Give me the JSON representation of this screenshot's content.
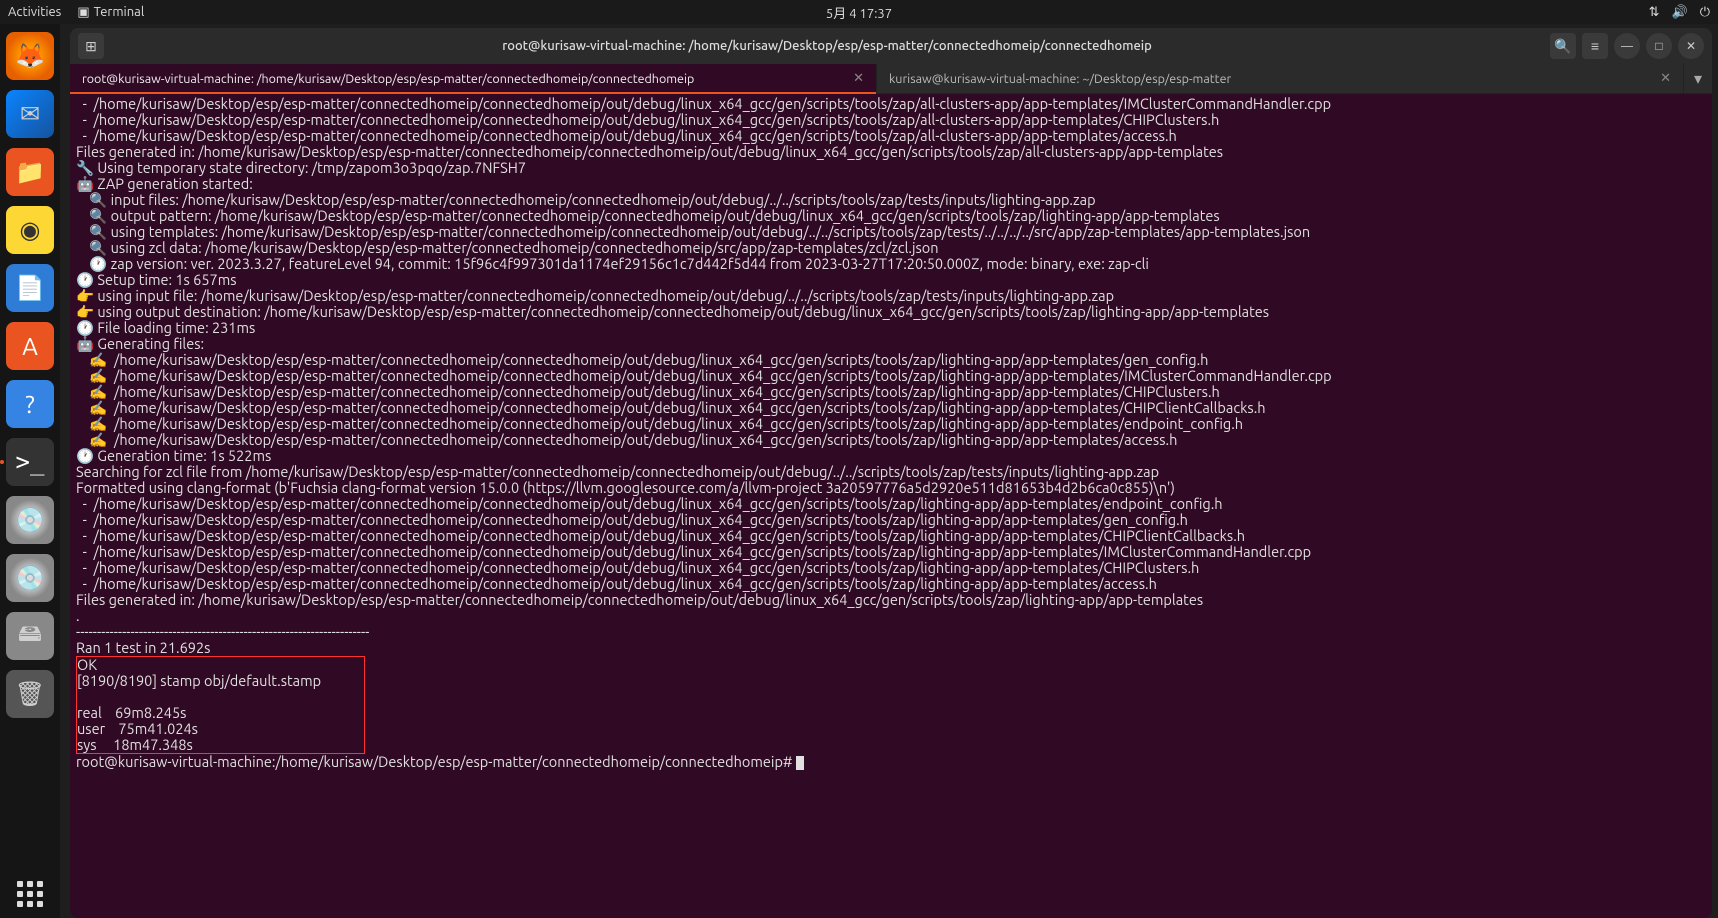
{
  "topbar": {
    "activities": "Activities",
    "app_name": "Terminal",
    "datetime": "5月 4  17:37"
  },
  "window": {
    "title": "root@kurisaw-virtual-machine: /home/kurisaw/Desktop/esp/esp-matter/connectedhomeip/connectedhomeip",
    "tabs": [
      {
        "label": "root@kurisaw-virtual-machine: /home/kurisaw/Desktop/esp/esp-matter/connectedhomeip/connectedhomeip",
        "active": true
      },
      {
        "label": "kurisaw@kurisaw-virtual-machine: ~/Desktop/esp/esp-matter",
        "active": false
      }
    ]
  },
  "dock": {
    "items": [
      "firefox",
      "thunderbird",
      "files",
      "rhythmbox",
      "writer",
      "software",
      "help",
      "terminal",
      "disc",
      "disc",
      "devices",
      "trash"
    ]
  },
  "terminal": {
    "lines": [
      "  -  /home/kurisaw/Desktop/esp/esp-matter/connectedhomeip/connectedhomeip/out/debug/linux_x64_gcc/gen/scripts/tools/zap/all-clusters-app/app-templates/IMClusterCommandHandler.cpp",
      "  -  /home/kurisaw/Desktop/esp/esp-matter/connectedhomeip/connectedhomeip/out/debug/linux_x64_gcc/gen/scripts/tools/zap/all-clusters-app/app-templates/CHIPClusters.h",
      "  -  /home/kurisaw/Desktop/esp/esp-matter/connectedhomeip/connectedhomeip/out/debug/linux_x64_gcc/gen/scripts/tools/zap/all-clusters-app/app-templates/access.h",
      "Files generated in: /home/kurisaw/Desktop/esp/esp-matter/connectedhomeip/connectedhomeip/out/debug/linux_x64_gcc/gen/scripts/tools/zap/all-clusters-app/app-templates",
      "🔧 Using temporary state directory: /tmp/zapom3o3pqo/zap.7NFSH7",
      "🤖 ZAP generation started:",
      "    🔍 input files: /home/kurisaw/Desktop/esp/esp-matter/connectedhomeip/connectedhomeip/out/debug/../../scripts/tools/zap/tests/inputs/lighting-app.zap",
      "    🔍 output pattern: /home/kurisaw/Desktop/esp/esp-matter/connectedhomeip/connectedhomeip/out/debug/linux_x64_gcc/gen/scripts/tools/zap/lighting-app/app-templates",
      "    🔍 using templates: /home/kurisaw/Desktop/esp/esp-matter/connectedhomeip/connectedhomeip/out/debug/../../scripts/tools/zap/tests/../../../../src/app/zap-templates/app-templates.json",
      "    🔍 using zcl data: /home/kurisaw/Desktop/esp/esp-matter/connectedhomeip/connectedhomeip/src/app/zap-templates/zcl/zcl.json",
      "    🕐 zap version: ver. 2023.3.27, featureLevel 94, commit: 15f96c4f997301da1174ef29156c1c7d442f5d44 from 2023-03-27T17:20:50.000Z, mode: binary, exe: zap-cli",
      "🕐 Setup time: 1s 657ms",
      "👉 using input file: /home/kurisaw/Desktop/esp/esp-matter/connectedhomeip/connectedhomeip/out/debug/../../scripts/tools/zap/tests/inputs/lighting-app.zap",
      "👉 using output destination: /home/kurisaw/Desktop/esp/esp-matter/connectedhomeip/connectedhomeip/out/debug/linux_x64_gcc/gen/scripts/tools/zap/lighting-app/app-templates",
      "🕐 File loading time: 231ms",
      "🤖 Generating files:",
      "    ✍  /home/kurisaw/Desktop/esp/esp-matter/connectedhomeip/connectedhomeip/out/debug/linux_x64_gcc/gen/scripts/tools/zap/lighting-app/app-templates/gen_config.h",
      "    ✍  /home/kurisaw/Desktop/esp/esp-matter/connectedhomeip/connectedhomeip/out/debug/linux_x64_gcc/gen/scripts/tools/zap/lighting-app/app-templates/IMClusterCommandHandler.cpp",
      "    ✍  /home/kurisaw/Desktop/esp/esp-matter/connectedhomeip/connectedhomeip/out/debug/linux_x64_gcc/gen/scripts/tools/zap/lighting-app/app-templates/CHIPClusters.h",
      "    ✍  /home/kurisaw/Desktop/esp/esp-matter/connectedhomeip/connectedhomeip/out/debug/linux_x64_gcc/gen/scripts/tools/zap/lighting-app/app-templates/CHIPClientCallbacks.h",
      "    ✍  /home/kurisaw/Desktop/esp/esp-matter/connectedhomeip/connectedhomeip/out/debug/linux_x64_gcc/gen/scripts/tools/zap/lighting-app/app-templates/endpoint_config.h",
      "    ✍  /home/kurisaw/Desktop/esp/esp-matter/connectedhomeip/connectedhomeip/out/debug/linux_x64_gcc/gen/scripts/tools/zap/lighting-app/app-templates/access.h",
      "🕐 Generation time: 1s 522ms",
      "Searching for zcl file from /home/kurisaw/Desktop/esp/esp-matter/connectedhomeip/connectedhomeip/out/debug/../../scripts/tools/zap/tests/inputs/lighting-app.zap",
      "Formatted using clang-format (b'Fuchsia clang-format version 15.0.0 (https://llvm.googlesource.com/a/llvm-project 3a20597776a5d2920e511d81653b4d2b6ca0c855)\\n')",
      "  -  /home/kurisaw/Desktop/esp/esp-matter/connectedhomeip/connectedhomeip/out/debug/linux_x64_gcc/gen/scripts/tools/zap/lighting-app/app-templates/endpoint_config.h",
      "  -  /home/kurisaw/Desktop/esp/esp-matter/connectedhomeip/connectedhomeip/out/debug/linux_x64_gcc/gen/scripts/tools/zap/lighting-app/app-templates/gen_config.h",
      "  -  /home/kurisaw/Desktop/esp/esp-matter/connectedhomeip/connectedhomeip/out/debug/linux_x64_gcc/gen/scripts/tools/zap/lighting-app/app-templates/CHIPClientCallbacks.h",
      "  -  /home/kurisaw/Desktop/esp/esp-matter/connectedhomeip/connectedhomeip/out/debug/linux_x64_gcc/gen/scripts/tools/zap/lighting-app/app-templates/IMClusterCommandHandler.cpp",
      "  -  /home/kurisaw/Desktop/esp/esp-matter/connectedhomeip/connectedhomeip/out/debug/linux_x64_gcc/gen/scripts/tools/zap/lighting-app/app-templates/CHIPClusters.h",
      "  -  /home/kurisaw/Desktop/esp/esp-matter/connectedhomeip/connectedhomeip/out/debug/linux_x64_gcc/gen/scripts/tools/zap/lighting-app/app-templates/access.h",
      "Files generated in: /home/kurisaw/Desktop/esp/esp-matter/connectedhomeip/connectedhomeip/out/debug/linux_x64_gcc/gen/scripts/tools/zap/lighting-app/app-templates",
      ".",
      "----------------------------------------------------------------------",
      "Ran 1 test in 21.692s",
      ""
    ],
    "boxed": [
      "OK",
      "[8190/8190] stamp obj/default.stamp",
      "",
      "real    69m8.245s",
      "user    75m41.024s",
      "sys     18m47.348s"
    ],
    "prompt": "root@kurisaw-virtual-machine:/home/kurisaw/Desktop/esp/esp-matter/connectedhomeip/connectedhomeip# "
  }
}
